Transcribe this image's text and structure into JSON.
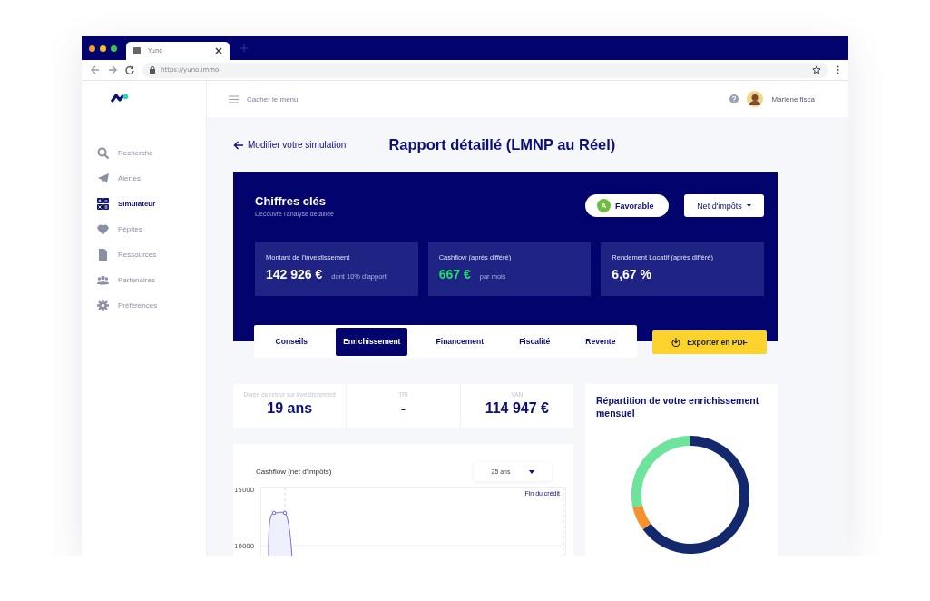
{
  "browser": {
    "tab_title": "Yuno",
    "url": "https://yuno.immo"
  },
  "header": {
    "menu_toggle": "Cacher le menu",
    "user_name": "Marlene fisca"
  },
  "sidebar": {
    "items": [
      {
        "label": "Recherche",
        "selected": false
      },
      {
        "label": "Alertes",
        "selected": false
      },
      {
        "label": "Simulateur",
        "selected": true
      },
      {
        "label": "Pépites",
        "selected": false
      },
      {
        "label": "Ressources",
        "selected": false
      },
      {
        "label": "Partenaires",
        "selected": false
      },
      {
        "label": "Préférences",
        "selected": false
      }
    ]
  },
  "page": {
    "back_link": "Modifier votre simulation",
    "title": "Rapport détaillé (LMNP au Réel)"
  },
  "key_figures": {
    "title": "Chiffres clés",
    "subtitle": "Découvre l'analyse détaillée",
    "rating": {
      "grade": "A",
      "label": "Favorable"
    },
    "tax_select": "Net d'impôts",
    "cards": [
      {
        "label": "Montant de l'investissement",
        "value": "142 926 €",
        "note": "dont 10% d'apport",
        "positive": false
      },
      {
        "label": "Cashflow (après différé)",
        "value": "667 €",
        "note": "par mois",
        "positive": true
      },
      {
        "label": "Rendement Locatif (après différé)",
        "value": "6,67 %",
        "positive": false
      }
    ]
  },
  "tabs": [
    {
      "label": "Conseils",
      "selected": false
    },
    {
      "label": "Enrichissement",
      "selected": true
    },
    {
      "label": "Financement",
      "selected": false
    },
    {
      "label": "Fiscalité",
      "selected": false
    },
    {
      "label": "Revente",
      "selected": false
    }
  ],
  "export_button": "Exporter en PDF",
  "stats": [
    {
      "label": "Durée de retour sur investissement",
      "value": "19 ans"
    },
    {
      "label": "TRI",
      "value": "-"
    },
    {
      "label": "VAN",
      "value": "114 947 €"
    }
  ],
  "cashflow_chart": {
    "title": "Cashflow (net d'impôts)",
    "period": "25 ans",
    "annotation": "Fin du crédit",
    "y_labels": [
      "15000",
      "10000"
    ]
  },
  "distribution": {
    "title": "Répartition de votre enrichissement mensuel"
  }
}
